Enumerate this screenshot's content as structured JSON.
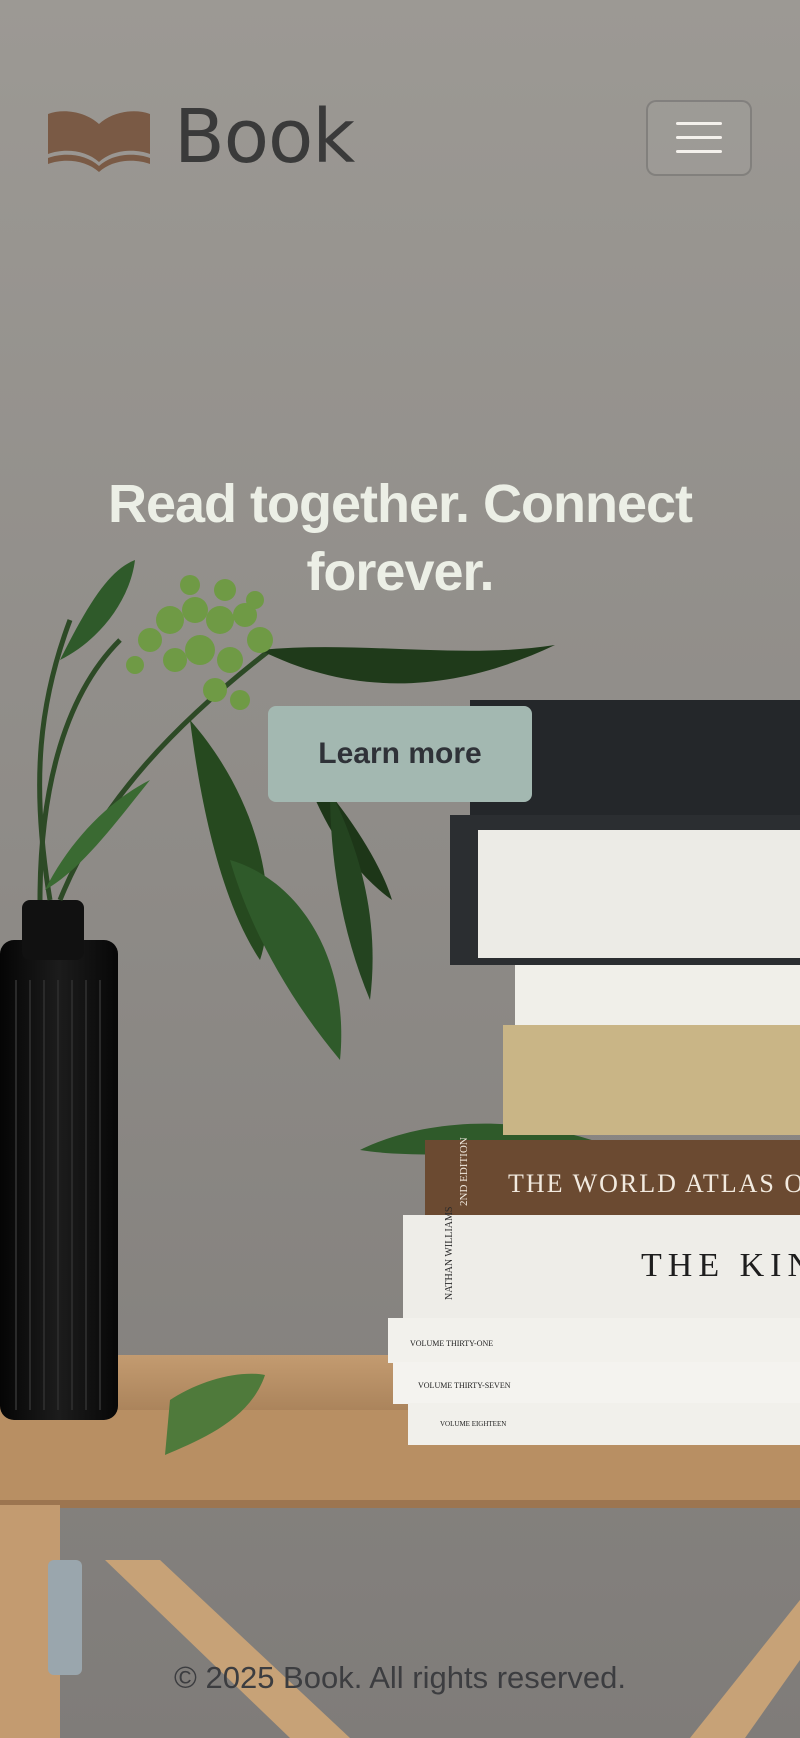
{
  "header": {
    "brand_name": "Book",
    "logo_icon": "open-book-icon",
    "menu_icon": "hamburger-menu-icon"
  },
  "hero": {
    "title": "Read together. Connect forever.",
    "cta_label": "Learn more"
  },
  "background": {
    "book_spines": [
      "THE WORLD ATLAS OF",
      "THE KIN"
    ],
    "spine_small": [
      "2ND EDITION",
      "NATHAN WILLIAMS"
    ],
    "volume_labels": [
      "VOLUME THIRTY-ONE",
      "VOLUME THIRTY-SEVEN",
      "VOLUME EIGHTEEN"
    ]
  },
  "footer": {
    "copyright": "© 2025 Book. All rights reserved."
  },
  "colors": {
    "logo_brown": "#7a5a45",
    "hero_text": "#ecefe6",
    "button_bg": "#a3b8b1",
    "button_text": "#2f3238"
  }
}
